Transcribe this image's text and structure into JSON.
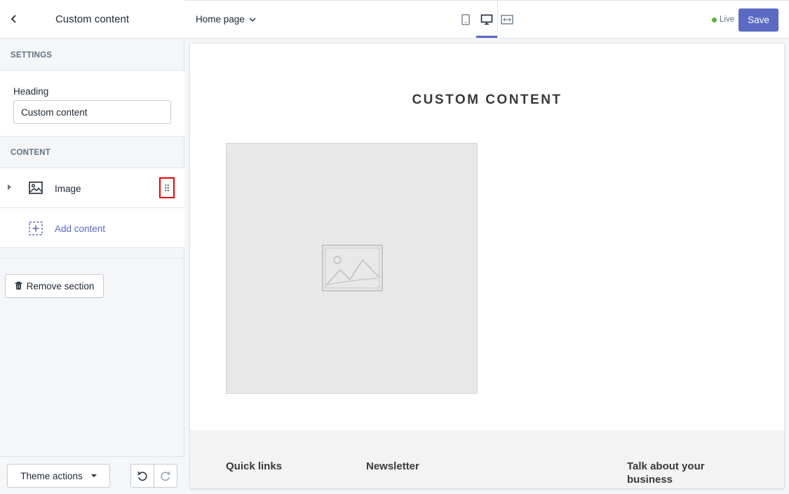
{
  "sidebar": {
    "title": "Custom content",
    "settings_label": "SETTINGS",
    "heading_field_label": "Heading",
    "heading_value": "Custom content",
    "content_label": "CONTENT",
    "blocks": [
      {
        "label": "Image"
      }
    ],
    "add_content_label": "Add content",
    "remove_section_label": "Remove section",
    "theme_actions_label": "Theme actions"
  },
  "topbar": {
    "page_select": "Home page",
    "live_label": "Live",
    "save_label": "Save",
    "active_view": "desktop"
  },
  "preview": {
    "section_heading": "CUSTOM CONTENT",
    "footer_columns": [
      "Quick links",
      "Newsletter",
      "Talk about your business"
    ]
  },
  "colors": {
    "accent": "#5c6ac4",
    "live": "#50b83c",
    "highlight": "#ee0000"
  }
}
